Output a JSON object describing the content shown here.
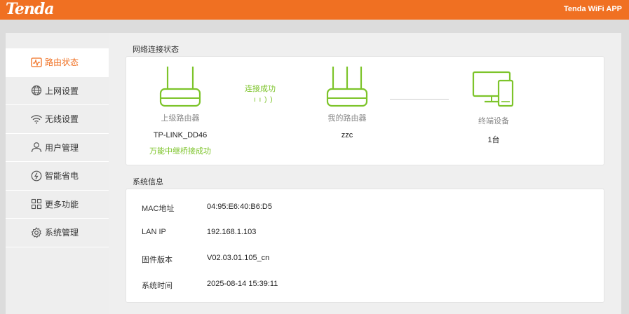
{
  "header": {
    "logo": "Tenda",
    "app_title": "Tenda WiFi APP",
    "brand_color": "#f07022"
  },
  "sidebar": {
    "items": [
      {
        "label": "路由状态",
        "icon": "pulse-icon",
        "active": true
      },
      {
        "label": "上网设置",
        "icon": "globe-icon",
        "active": false
      },
      {
        "label": "无线设置",
        "icon": "wifi-icon",
        "active": false
      },
      {
        "label": "用户管理",
        "icon": "user-icon",
        "active": false
      },
      {
        "label": "智能省电",
        "icon": "power-saving-icon",
        "active": false
      },
      {
        "label": "更多功能",
        "icon": "grid-icon",
        "active": false
      },
      {
        "label": "系统管理",
        "icon": "gear-icon",
        "active": false
      }
    ]
  },
  "network": {
    "title": "网络连接状态",
    "accent_color": "#7dc42a",
    "upstream": {
      "caption": "上级路由器",
      "name": "TP-LINK_DD46",
      "status": "万能中继桥接成功"
    },
    "connection_status": "连接成功",
    "signal_glyph": "ı ı ) )",
    "my_router": {
      "caption": "我的路由器",
      "name": "zzc"
    },
    "terminals": {
      "caption": "终端设备",
      "count": "1台"
    }
  },
  "system": {
    "title": "系统信息",
    "rows": [
      {
        "label": "MAC地址",
        "value": "04:95:E6:40:B6:D5"
      },
      {
        "label": "LAN IP",
        "value": "192.168.1.103"
      },
      {
        "label": "固件版本",
        "value": "V02.03.01.105_cn"
      },
      {
        "label": "系统时间",
        "value": "2025-08-14 15:39:11"
      }
    ]
  }
}
